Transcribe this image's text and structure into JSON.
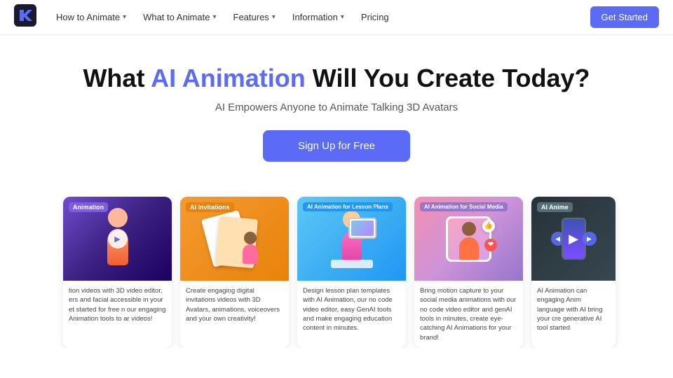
{
  "nav": {
    "logo_alt": "Krikey AI Logo",
    "links": [
      {
        "label": "How to Animate",
        "has_dropdown": true
      },
      {
        "label": "What to Animate",
        "has_dropdown": true
      },
      {
        "label": "Features",
        "has_dropdown": true
      },
      {
        "label": "Information",
        "has_dropdown": true
      },
      {
        "label": "Pricing",
        "has_dropdown": false
      }
    ],
    "cta_label": "Get Started"
  },
  "hero": {
    "heading_part1": "What ",
    "heading_highlight": "AI Animation",
    "heading_part2": " Will You Create Today?",
    "subheading": "AI Empowers Anyone to Animate Talking 3D Avatars",
    "cta_label": "Sign Up for Free"
  },
  "cards": [
    {
      "id": "card-animation",
      "label": "Animation",
      "label_color": "#7c5ce0",
      "bg_from": "#6e4dcf",
      "bg_to": "#1a0060",
      "description": "tion videos with 3D video editor, ers and facial accessible in your et started for free n our engaging Animation tools to ar videos!",
      "partial": "left"
    },
    {
      "id": "card-invitations",
      "label": "AI Invitations",
      "label_color": "#e8820a",
      "bg_from": "#f59a30",
      "bg_to": "#e8820a",
      "description": "Create engaging digital invitations videos with 3D Avatars, animations, voiceovers and your own creativity!"
    },
    {
      "id": "card-lesson-plans",
      "label": "AI Animation for Lesson Plans",
      "label_color": "#2196f3",
      "bg_from": "#5bc8f5",
      "bg_to": "#2196f3",
      "description": "Design lesson plan templates with AI Animation, our no code video editor, easy GenAI tools and make engaging education content in minutes."
    },
    {
      "id": "card-social-media",
      "label": "AI Animation for Social Media",
      "label_color": "#9575cd",
      "bg_from": "#f48fb1",
      "bg_to": "#9575cd",
      "description": "Bring motion capture to your social media animations with our no code video editor and genAI tools in minutes, create eye-catching AI Animations for your brand!"
    },
    {
      "id": "card-anime",
      "label": "AI Anime",
      "label_color": "#546e7a",
      "bg_from": "#263238",
      "bg_to": "#37474f",
      "description": "AI Animation can engaging Anim language with AI bring your cre generative AI tool started",
      "partial": "right"
    }
  ]
}
